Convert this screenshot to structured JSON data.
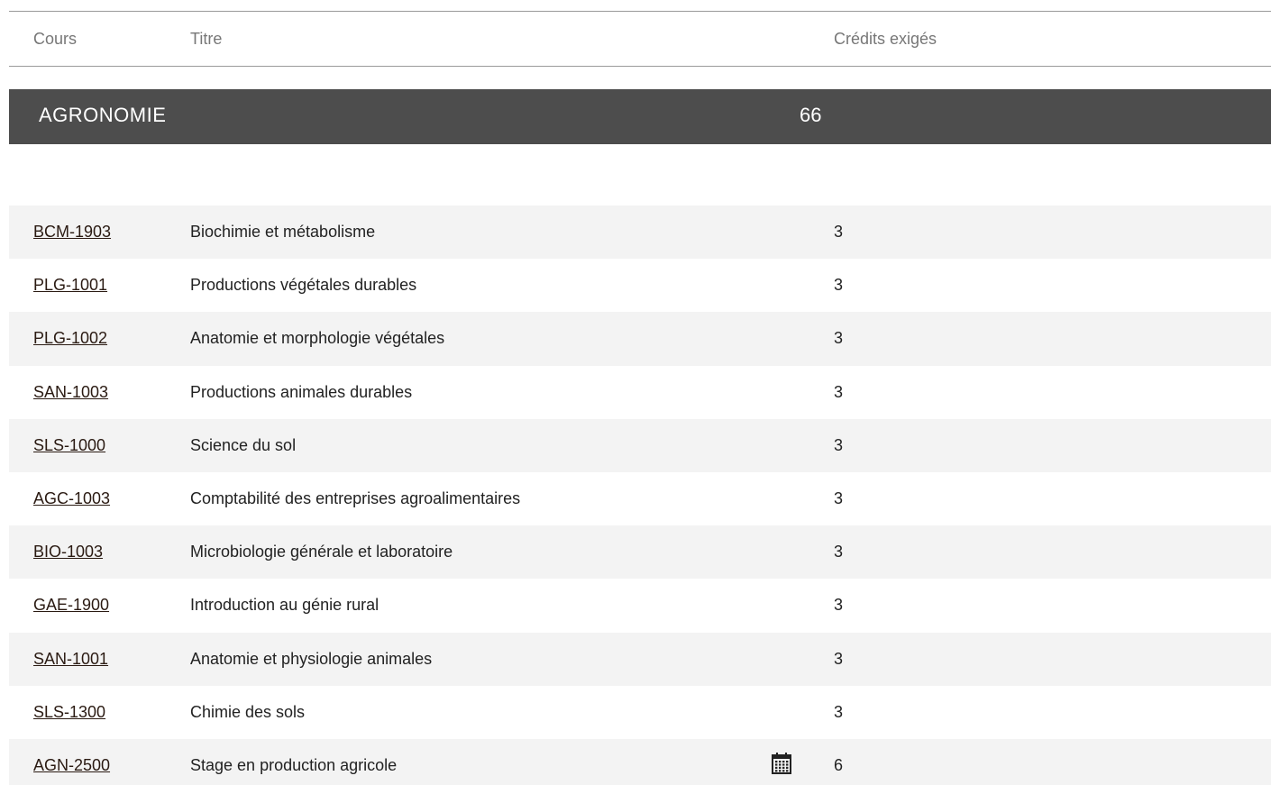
{
  "table_header": {
    "code": "Cours",
    "title": "Titre",
    "credits": "Crédits exigés"
  },
  "section": {
    "name": "AGRONOMIE",
    "credits": "66"
  },
  "courses": [
    {
      "code": "BCM-1903",
      "title": "Biochimie et métabolisme",
      "credits": "3",
      "icon": ""
    },
    {
      "code": "PLG-1001",
      "title": "Productions végétales durables",
      "credits": "3",
      "icon": ""
    },
    {
      "code": "PLG-1002",
      "title": "Anatomie et morphologie végétales",
      "credits": "3",
      "icon": ""
    },
    {
      "code": "SAN-1003",
      "title": "Productions animales durables",
      "credits": "3",
      "icon": ""
    },
    {
      "code": "SLS-1000",
      "title": "Science du sol",
      "credits": "3",
      "icon": ""
    },
    {
      "code": "AGC-1003",
      "title": "Comptabilité des entreprises agroalimentaires",
      "credits": "3",
      "icon": ""
    },
    {
      "code": "BIO-1003",
      "title": "Microbiologie générale et laboratoire",
      "credits": "3",
      "icon": ""
    },
    {
      "code": "GAE-1900",
      "title": "Introduction au génie rural",
      "credits": "3",
      "icon": ""
    },
    {
      "code": "SAN-1001",
      "title": "Anatomie et physiologie animales",
      "credits": "3",
      "icon": ""
    },
    {
      "code": "SLS-1300",
      "title": "Chimie des sols",
      "credits": "3",
      "icon": ""
    },
    {
      "code": "AGN-2500",
      "title": "Stage en production agricole",
      "credits": "6",
      "icon": "calendar-icon"
    }
  ],
  "colors": {
    "section_bar": "#4d4d4d",
    "row_alt": "#f3f3f3",
    "link": "#2a1a12"
  }
}
